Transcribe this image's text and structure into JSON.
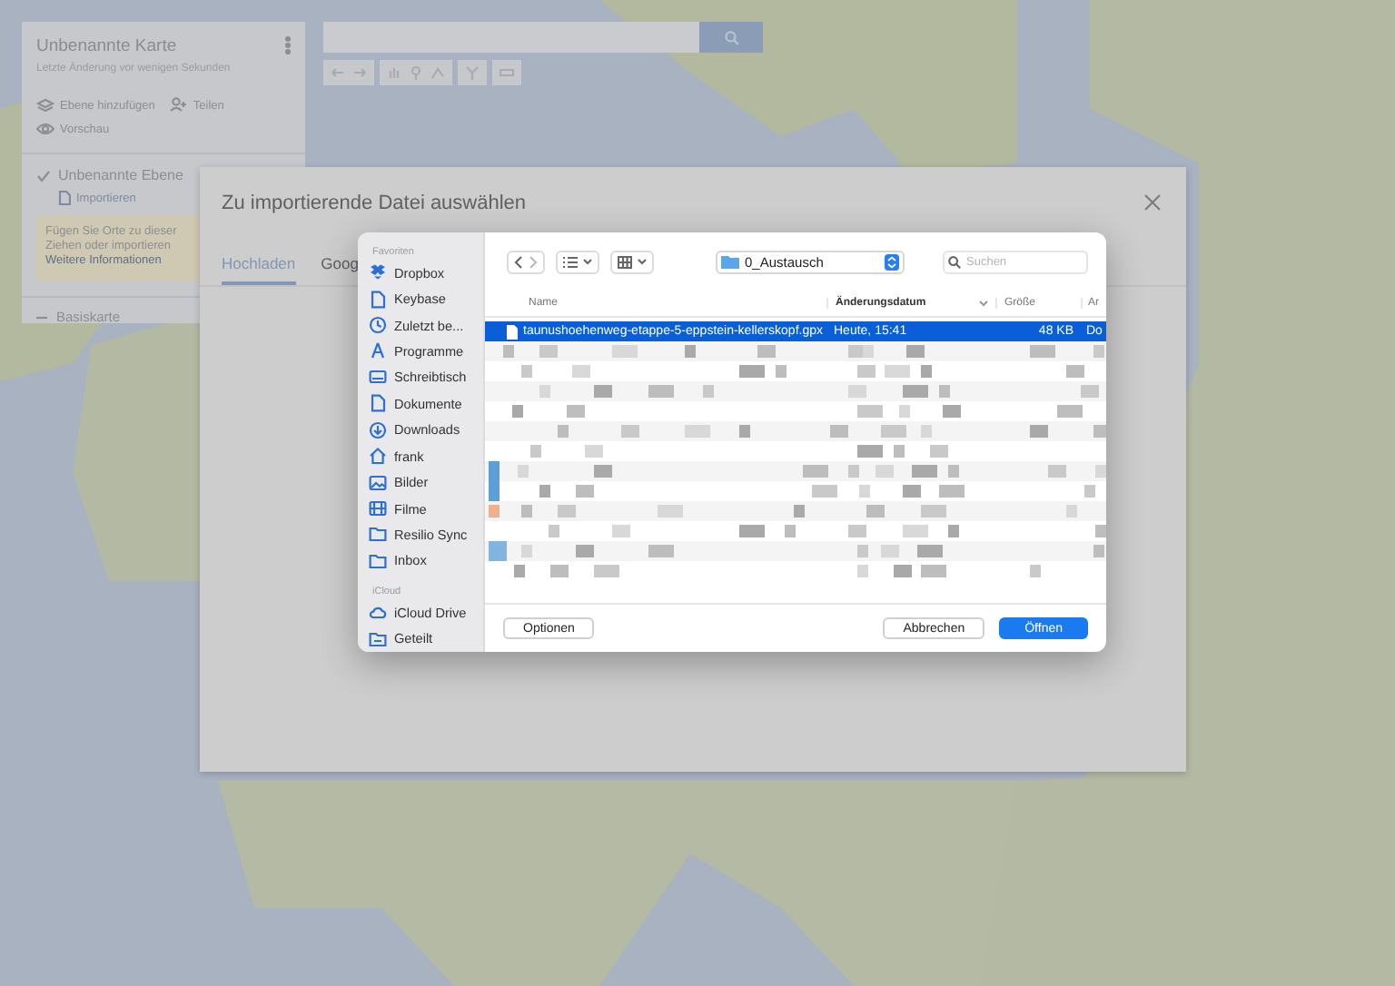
{
  "map_panel": {
    "title": "Unbenannte Karte",
    "subtitle": "Letzte Änderung vor wenigen Sekunden",
    "actions": [
      {
        "label": "Ebene hinzufügen"
      },
      {
        "label": "Teilen"
      },
      {
        "label": "Vorschau"
      }
    ],
    "layer": {
      "name": "Unbenannte Ebene",
      "checked": true,
      "import_link": "Importieren",
      "hint_lines": [
        "Fügen Sie Orte zu dieser",
        "Ziehen oder importieren"
      ],
      "hint_link": "Weitere Informationen"
    },
    "base_map": "Basiskarte"
  },
  "import_dialog": {
    "title": "Zu importierende Datei auswählen",
    "tabs": [
      {
        "label": "Hochladen",
        "selected": true
      },
      {
        "label": "Goog",
        "selected": false
      }
    ]
  },
  "file_dialog": {
    "sidebar": [
      {
        "heading": "Favoriten",
        "items": [
          "Dropbox",
          "Keybase",
          "Zuletzt be...",
          "Programme",
          "Schreibtisch",
          "Dokumente",
          "Downloads",
          "frank",
          "Bilder",
          "Filme",
          "Resilio Sync",
          "Inbox"
        ]
      },
      {
        "heading": "iCloud",
        "items": [
          "iCloud Drive",
          "Geteilt"
        ]
      }
    ],
    "folder": "0_Austausch",
    "search": {
      "placeholder": "Suchen"
    },
    "columns": [
      {
        "label": "Name",
        "sorted": false
      },
      {
        "label": "Änderungsdatum",
        "sorted": true
      },
      {
        "label": "Größe",
        "sorted": false
      },
      {
        "label": "Ar",
        "sorted": false
      }
    ],
    "files": [
      {
        "name": "taunushoehenweg-etappe-5-eppstein-kellerskopf.gpx",
        "modified": "Heute, 15:41",
        "size": "48 KB",
        "kind": "Do",
        "selected": true
      }
    ],
    "buttons": [
      {
        "label": "Optionen",
        "default": false
      },
      {
        "label": "Abbrechen",
        "default": false
      },
      {
        "label": "Öffnen",
        "default": true
      }
    ]
  }
}
